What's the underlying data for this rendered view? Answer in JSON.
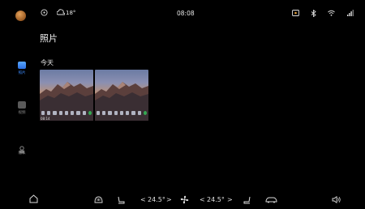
{
  "status_bar": {
    "weather_temp": "18°",
    "time": "08:08"
  },
  "page": {
    "title": "照片",
    "section_label": "今天"
  },
  "rail": {
    "items": [
      {
        "label": "照片",
        "icon": "photos-icon",
        "active": true
      },
      {
        "label": "视频",
        "icon": "video-icon",
        "active": false
      },
      {
        "label": "隐私",
        "icon": "privacy-icon",
        "active": false
      }
    ]
  },
  "photos": [
    {
      "caption": "08:14"
    },
    {
      "caption": ""
    }
  ],
  "dock": {
    "left_temp": "24.5°",
    "right_temp": "24.5°"
  },
  "colors": {
    "accent": "#3d8cff",
    "background": "#000000"
  }
}
